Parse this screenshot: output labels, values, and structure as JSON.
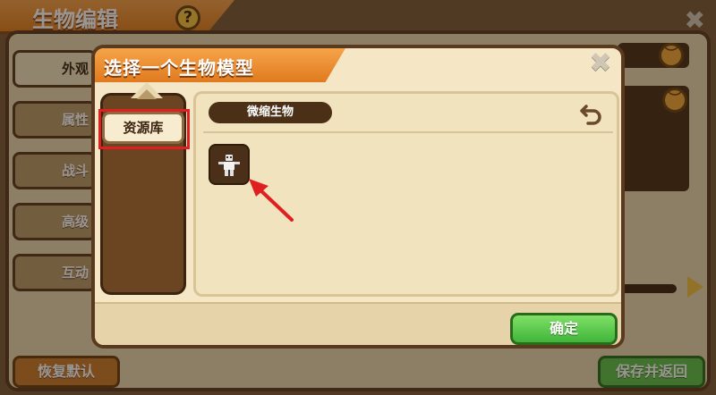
{
  "background": {
    "title": "生物编辑",
    "help_symbol": "?",
    "close_symbol": "✖",
    "tabs": [
      "外观",
      "属性",
      "战斗",
      "高级",
      "互动"
    ],
    "reset_label": "恢复默认",
    "save_label": "保存并返回"
  },
  "dialog": {
    "title": "选择一个生物模型",
    "close_symbol": "✖",
    "library_label": "资源库",
    "category_label": "微缩生物",
    "confirm_label": "确定",
    "items": [
      {
        "icon": "mini-creature-figure-icon"
      }
    ]
  },
  "colors": {
    "ribbon": "#e98a2c",
    "panel": "#f5e7c6",
    "frame": "#5a3a1e",
    "confirm": "#40b53a",
    "highlight": "#e02020"
  }
}
